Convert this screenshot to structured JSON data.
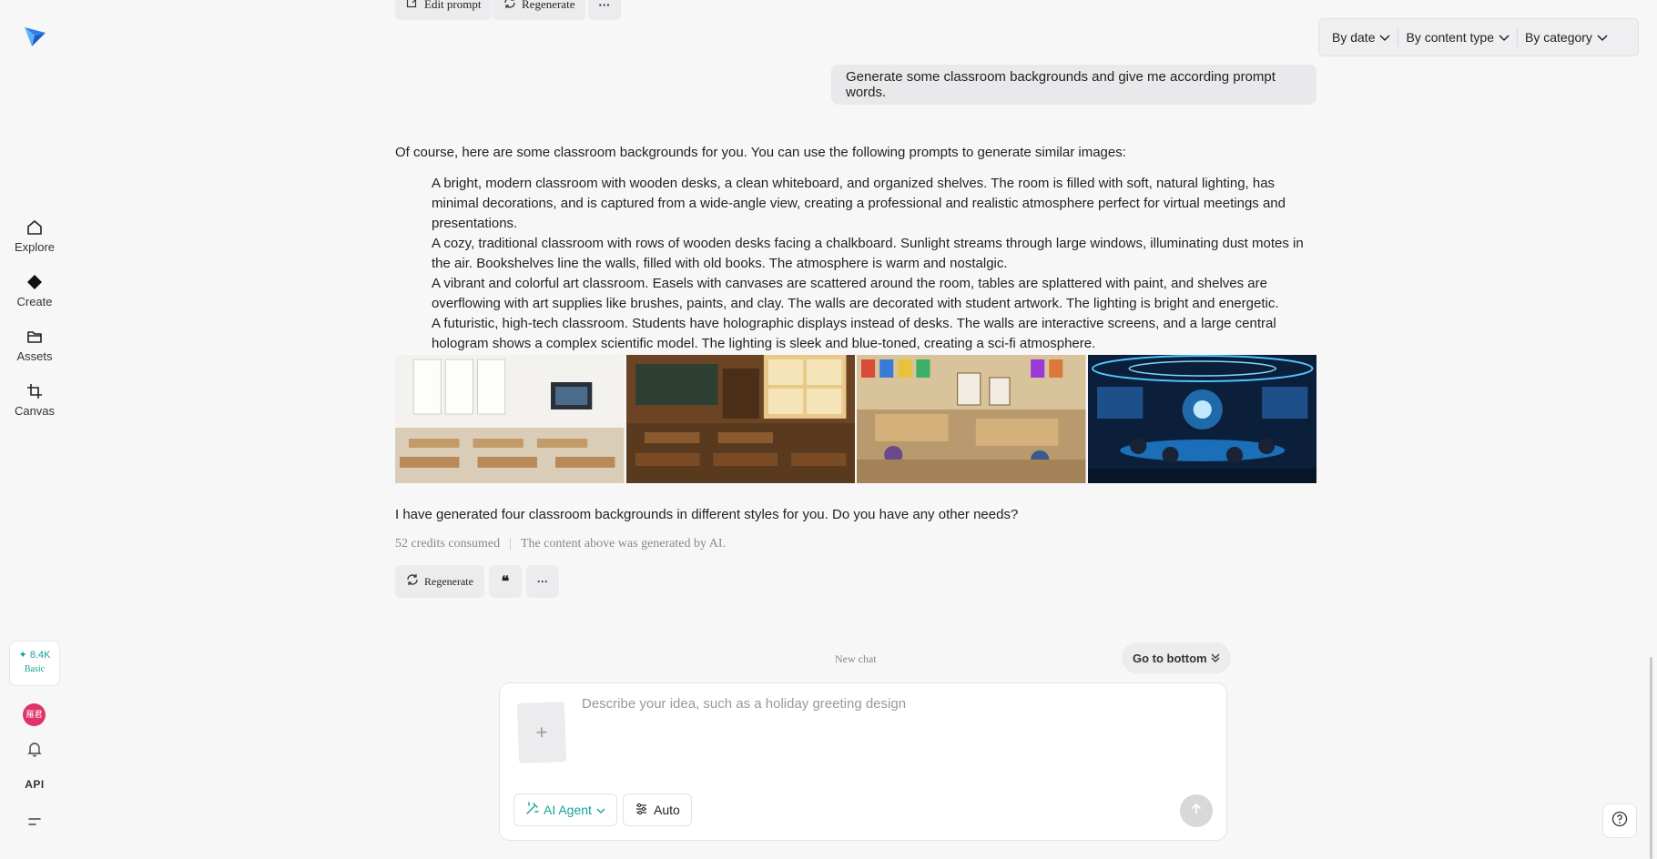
{
  "sidebar": {
    "logo_icon": "paper-plane-logo-icon",
    "nav": [
      {
        "label": "Explore",
        "icon": "home-icon"
      },
      {
        "label": "Create",
        "icon": "diamond-icon"
      },
      {
        "label": "Assets",
        "icon": "folder-icon"
      },
      {
        "label": "Canvas",
        "icon": "crop-icon"
      }
    ],
    "credits": {
      "amount": "✦ 8.4K",
      "plan": "Basic"
    },
    "avatar_text": "羅君",
    "api_label": "API"
  },
  "top_actions": {
    "edit_prompt_label": "Edit prompt",
    "regenerate_label": "Regenerate",
    "more_label": "···"
  },
  "filters": {
    "by_date": "By date",
    "by_content_type": "By content type",
    "by_category": "By category"
  },
  "user_message": "Generate some classroom backgrounds and give me according prompt words.",
  "assistant": {
    "intro": "Of course, here are some classroom backgrounds for you. You can use the following prompts to generate similar images:",
    "prompts": [
      "A bright, modern classroom with wooden desks, a clean whiteboard, and organized shelves. The room is filled with soft, natural lighting, has minimal decorations, and is captured from a wide-angle view, creating a professional and realistic atmosphere perfect for virtual meetings and presentations.",
      "A cozy, traditional classroom with rows of wooden desks facing a chalkboard. Sunlight streams through large windows, illuminating dust motes in the air. Bookshelves line the walls, filled with old books. The atmosphere is warm and nostalgic.",
      "A vibrant and colorful art classroom. Easels with canvases are scattered around the room, tables are splattered with paint, and shelves are overflowing with art supplies like brushes, paints, and clay. The walls are decorated with student artwork. The lighting is bright and energetic.",
      "A futuristic, high-tech classroom. Students have holographic displays instead of desks. The walls are interactive screens, and a large central hologram shows a complex scientific model. The lighting is sleek and blue-toned, creating a sci-fi atmosphere."
    ],
    "images": [
      "modern-classroom",
      "traditional-classroom",
      "art-classroom",
      "futuristic-classroom"
    ],
    "followup": "I have generated four classroom backgrounds in different styles for you. Do you have any other needs?",
    "credits_consumed": "52 credits consumed",
    "ai_notice": "The content above was generated by AI.",
    "regenerate_label": "Regenerate",
    "quote_label": "❝",
    "more_label": "···"
  },
  "new_chat_label": "New chat",
  "go_bottom_label": "Go to bottom",
  "composer": {
    "placeholder": "Describe your idea, such as a holiday greeting design",
    "value": "",
    "upload_label": "+",
    "agent_label": "AI Agent",
    "mode_label": "Auto"
  },
  "colors": {
    "accent": "#14a39a",
    "avatar_bg": "#e0336a",
    "logo_blue": "#2f80ed"
  }
}
